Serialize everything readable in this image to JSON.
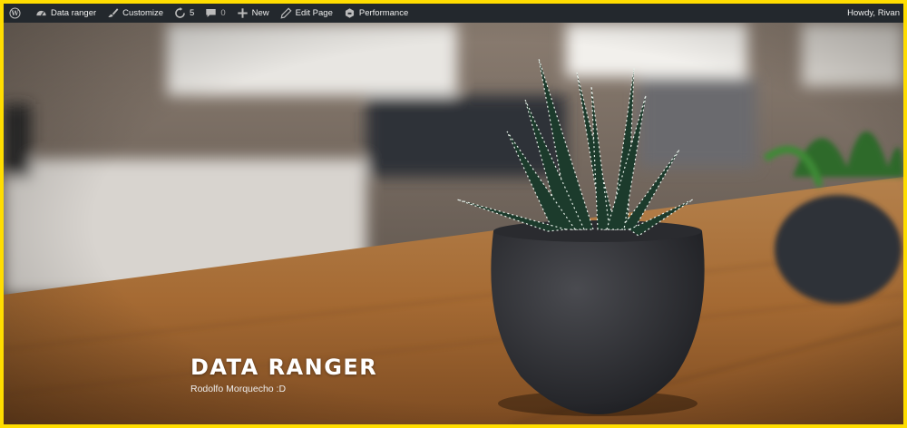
{
  "adminbar": {
    "items": [
      {
        "icon": "wordpress-logo-icon",
        "label": ""
      },
      {
        "icon": "dashboard-icon",
        "label": "Data ranger"
      },
      {
        "icon": "paintbrush-icon",
        "label": "Customize"
      },
      {
        "icon": "updates-icon",
        "label": "5"
      },
      {
        "icon": "comments-icon",
        "label": "0"
      },
      {
        "icon": "plus-icon",
        "label": "New"
      },
      {
        "icon": "pencil-icon",
        "label": "Edit Page"
      },
      {
        "icon": "performance-icon",
        "label": "Performance"
      }
    ],
    "account": "Howdy, Rivan"
  },
  "hero": {
    "title": "DATA RANGER",
    "description": "Rodolfo Morquecho :D"
  },
  "colors": {
    "frame": "#ffdd00",
    "adminbar_bg": "#23282d",
    "text_light": "#eeeeee"
  }
}
